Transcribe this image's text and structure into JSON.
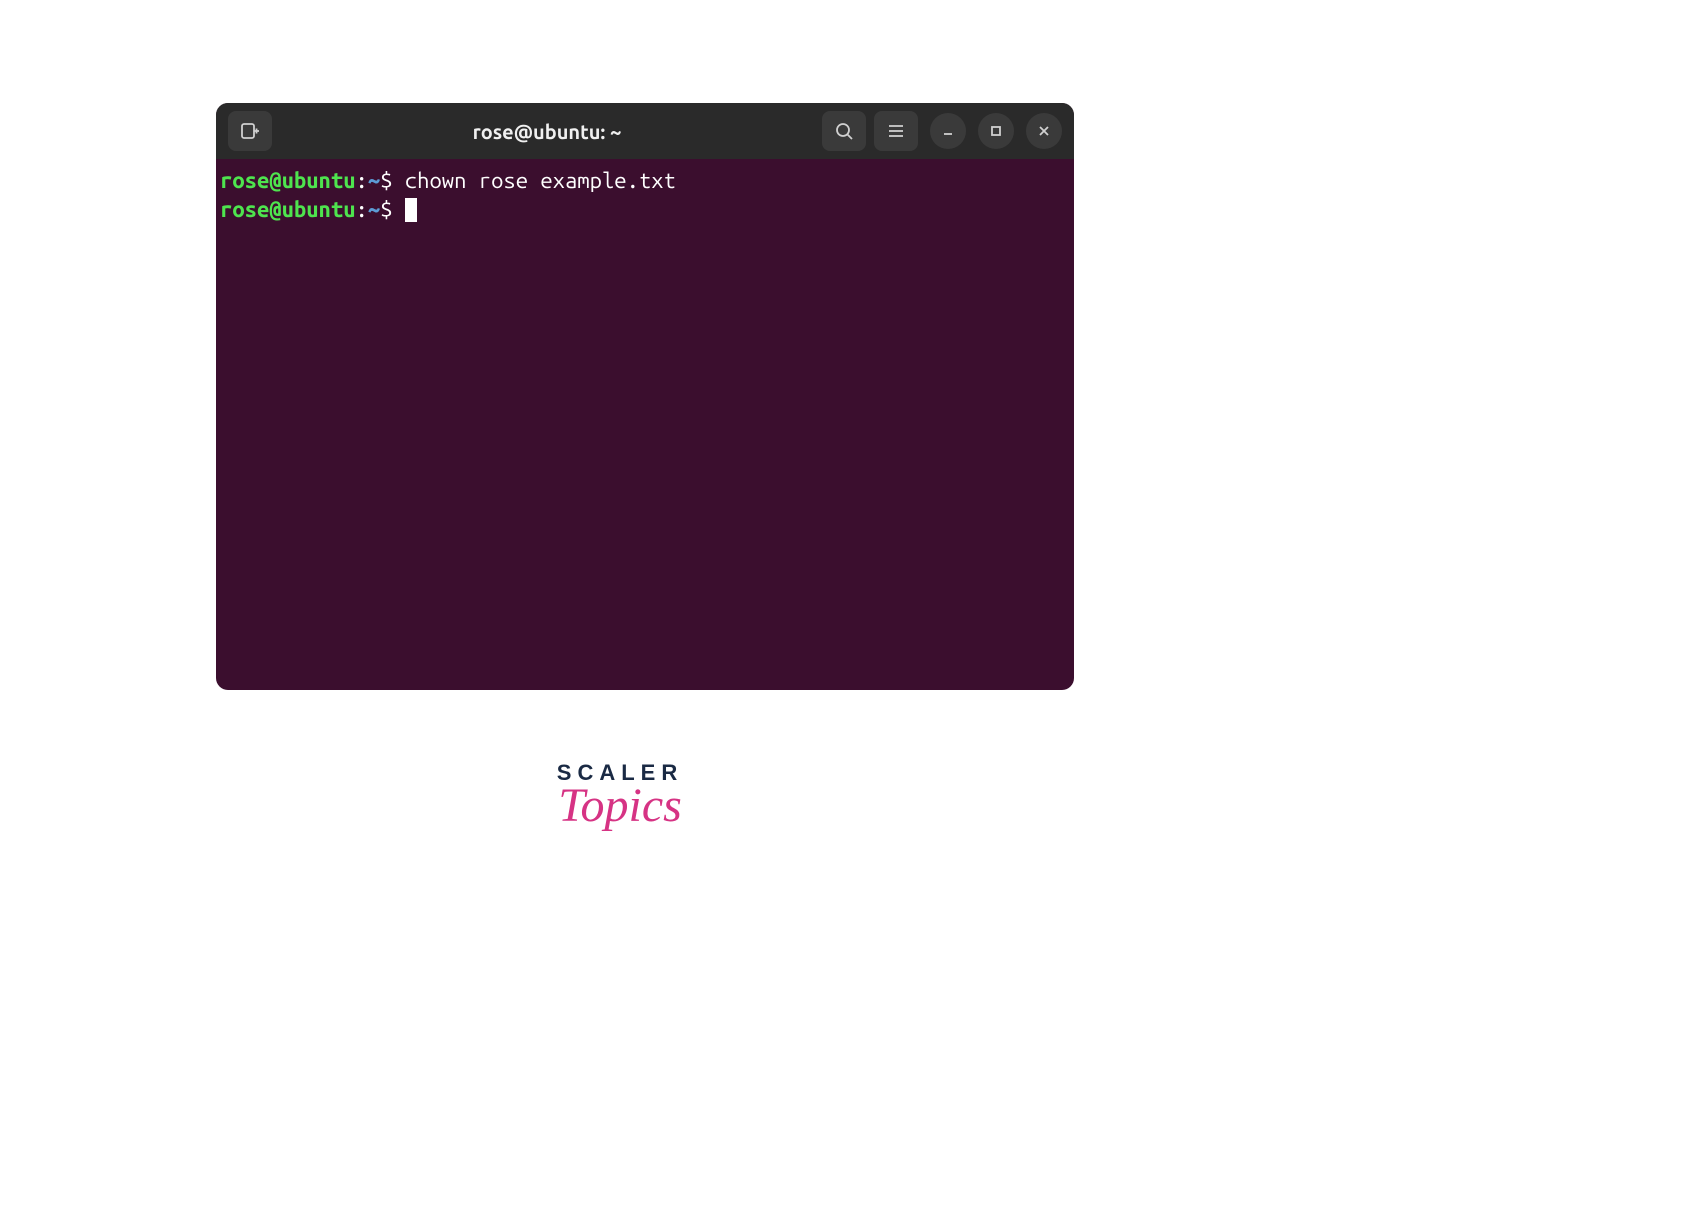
{
  "window": {
    "title": "rose@ubuntu: ~"
  },
  "terminal": {
    "lines": [
      {
        "prompt_user": "rose@ubuntu",
        "prompt_colon": ":",
        "prompt_path": "~",
        "prompt_dollar": "$ ",
        "command": "chown rose example.txt"
      },
      {
        "prompt_user": "rose@ubuntu",
        "prompt_colon": ":",
        "prompt_path": "~",
        "prompt_dollar": "$ ",
        "command": ""
      }
    ]
  },
  "logo": {
    "line1": "SCALER",
    "line2": "Topics"
  },
  "colors": {
    "terminal_bg": "#3b0e2e",
    "titlebar_bg": "#2a2a2a",
    "prompt_green": "#4ee44e",
    "prompt_blue": "#5c9cd6",
    "text_white": "#ffffff"
  }
}
